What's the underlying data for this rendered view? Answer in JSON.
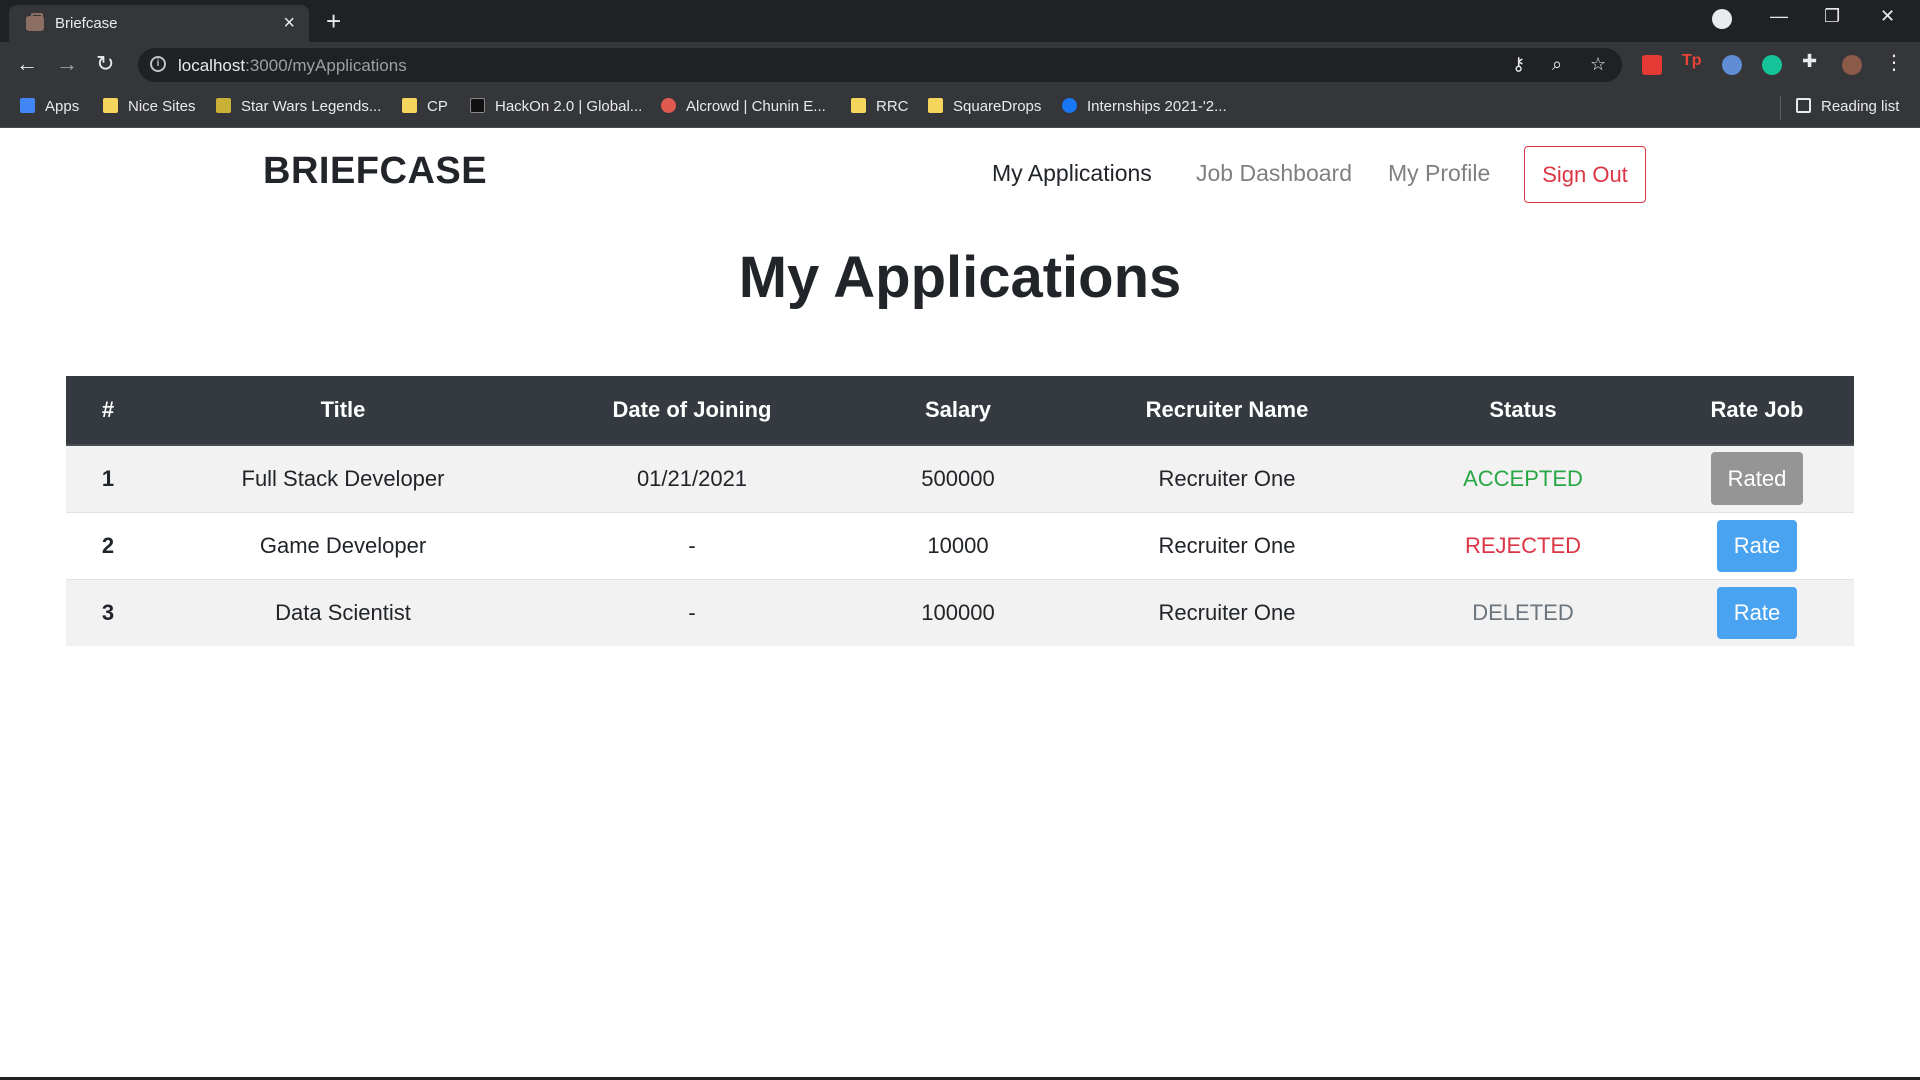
{
  "browser": {
    "tab_title": "Briefcase",
    "url_host": "localhost",
    "url_path": ":3000/myApplications",
    "bookmarks": [
      {
        "label": "Apps"
      },
      {
        "label": "Nice Sites"
      },
      {
        "label": "Star Wars Legends..."
      },
      {
        "label": "CP"
      },
      {
        "label": "HackOn 2.0 | Global..."
      },
      {
        "label": "Alcrowd | Chunin E..."
      },
      {
        "label": "RRC"
      },
      {
        "label": "SquareDrops"
      },
      {
        "label": "Internships 2021-'2..."
      }
    ],
    "reading_list": "Reading list"
  },
  "navbar": {
    "brand": "BRIEFCASE",
    "links": [
      "My Applications",
      "Job Dashboard",
      "My Profile"
    ],
    "signout": "Sign Out"
  },
  "page": {
    "title": "My Applications"
  },
  "table": {
    "headers": [
      "#",
      "Title",
      "Date of Joining",
      "Salary",
      "Recruiter Name",
      "Status",
      "Rate Job"
    ],
    "rows": [
      {
        "num": "1",
        "title": "Full Stack Developer",
        "date": "01/21/2021",
        "salary": "500000",
        "recruiter": "Recruiter One",
        "status": "ACCEPTED",
        "action": "Rated"
      },
      {
        "num": "2",
        "title": "Game Developer",
        "date": "-",
        "salary": "10000",
        "recruiter": "Recruiter One",
        "status": "REJECTED",
        "action": "Rate"
      },
      {
        "num": "3",
        "title": "Data Scientist",
        "date": "-",
        "salary": "100000",
        "recruiter": "Recruiter One",
        "status": "DELETED",
        "action": "Rate"
      }
    ]
  },
  "colors": {
    "accepted": "#28a745",
    "rejected": "#dc3545",
    "deleted": "#6c757d",
    "rate_button": "#4aa3f0",
    "rated_button": "#959595",
    "table_header": "#343a40"
  }
}
